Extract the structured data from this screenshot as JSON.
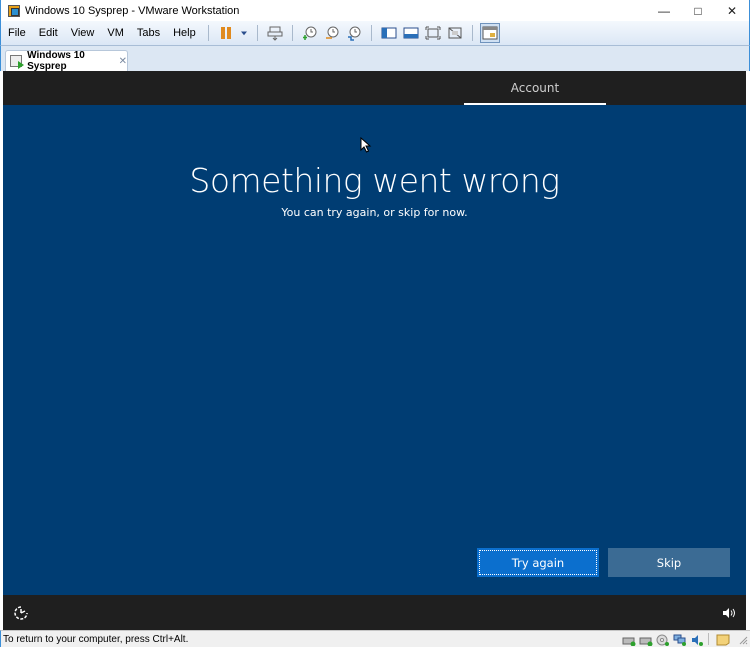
{
  "window": {
    "title": "Windows 10 Sysprep - VMware Workstation",
    "controls": {
      "minimize": "—",
      "maximize": "□",
      "close": "✕"
    }
  },
  "menubar": {
    "items": [
      "File",
      "Edit",
      "View",
      "VM",
      "Tabs",
      "Help"
    ]
  },
  "toolbar": {
    "icons": [
      "pause-icon",
      "dropdown-arrow-icon",
      "send-ctrl-alt-del-icon",
      "take-snapshot-icon",
      "revert-snapshot-icon",
      "snapshot-manager-icon",
      "show-library-icon",
      "fullscreen-console-icon",
      "fit-guest-icon",
      "unity-icon",
      "console-view-icon"
    ]
  },
  "tabs": [
    {
      "label": "Windows 10 Sysprep",
      "close": "✕"
    }
  ],
  "guest": {
    "top_tab": "Account",
    "heading": "Something went wrong",
    "subtext": "You can try again, or skip for now.",
    "buttons": {
      "try_again": "Try again",
      "skip": "Skip"
    },
    "colors": {
      "background": "#003d73",
      "primary_button": "#0b6fce",
      "secondary_button": "#3b6b94",
      "bar": "#1f1f1f"
    }
  },
  "statusbar": {
    "text": "To return to your computer, press Ctrl+Alt.",
    "devices": [
      "hard-disk-icon",
      "hard-disk-2-icon",
      "cd-dvd-icon",
      "network-icon",
      "sound-card-icon",
      "message-log-icon"
    ]
  }
}
